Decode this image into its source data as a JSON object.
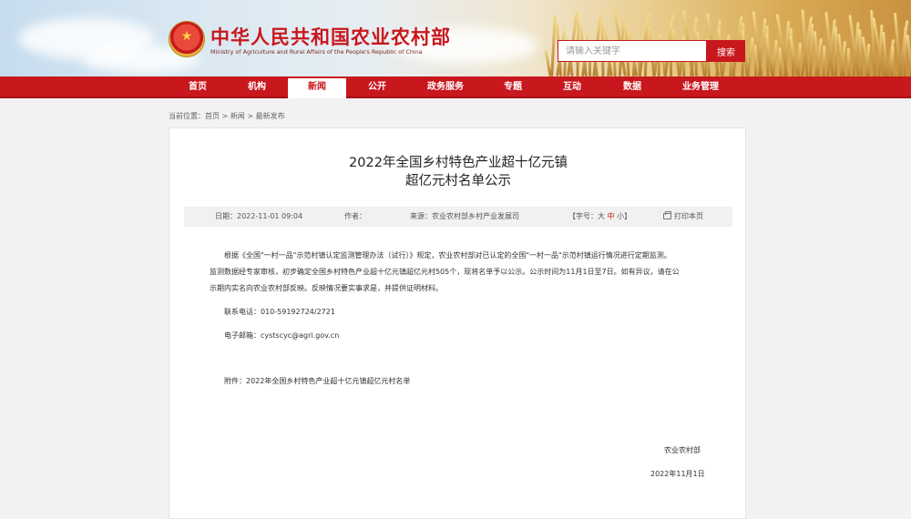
{
  "header": {
    "site_title": "中华人民共和国农业农村部",
    "site_subtitle": "Ministry of Agriculture and Rural Affairs of the People's Republic of China",
    "emblem_glyph": "★",
    "search": {
      "placeholder": "请输入关键字",
      "button_label": "搜索"
    }
  },
  "nav": {
    "items": [
      {
        "label": "首页"
      },
      {
        "label": "机构"
      },
      {
        "label": "新闻",
        "active": true
      },
      {
        "label": "公开"
      },
      {
        "label": "政务服务"
      },
      {
        "label": "专题"
      },
      {
        "label": "互动"
      },
      {
        "label": "数据"
      },
      {
        "label": "业务管理"
      }
    ]
  },
  "breadcrumb": {
    "prefix": "当前位置：",
    "items": [
      "首页",
      "新闻",
      "最新发布"
    ],
    "separator": " > "
  },
  "article": {
    "title_line1": "2022年全国乡村特色产业超十亿元镇",
    "title_line2": "超亿元村名单公示",
    "meta": {
      "date_label": "日期：",
      "date_value": "2022-11-01 09:04",
      "author_label": "作者：",
      "source_label": "来源：",
      "source_value": "农业农村部乡村产业发展司",
      "font_size_label": "【字号：",
      "font_sizes": [
        "大",
        "中",
        "小"
      ],
      "font_size_end": "】",
      "print_label": "打印本页"
    },
    "body_lines": [
      "根据《全国\"一村一品\"示范村镇认定监测管理办法（试行）》规定，农业农村部对已认定的全国\"一村一品\"示范村镇运行情况进行定期监测。",
      "监测数据经专家审核，初步确定全国乡村特色产业超十亿元镇超亿元村505个，现将名单予以公示。公示时间为11月1日至7日。如有异议，请在公",
      "示期内实名向农业农村部反映。反映情况要实事求是，并提供证明材料。"
    ],
    "contact_phone": "联系电话：010-59192724/2721",
    "contact_email": "电子邮箱：cystscyc@agri.gov.cn",
    "attachment": "附件：2022年全国乡村特色产业超十亿元镇超亿元村名单",
    "signature_org": "农业农村部",
    "signature_date": "2022年11月1日"
  },
  "colors": {
    "brand_red": "#c8171d",
    "page_bg": "#f2f2f2"
  }
}
